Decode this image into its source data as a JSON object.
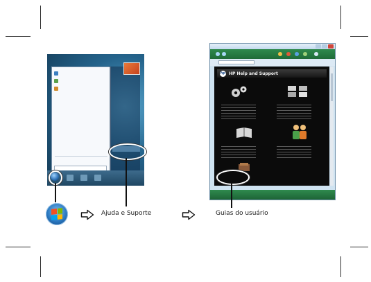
{
  "colors": {
    "desktop": "#1c4a6c",
    "start_menu_left": "#f7f9fc",
    "help_window_chrome": "#cfe3f1",
    "help_window_green_bar": "#2f8a4e",
    "help_body": "#0b0b0b",
    "callout_ring": "#ffffff"
  },
  "icons": {
    "start_orb": "windows-start-orb-icon",
    "step_arrow": "outline-right-arrow-icon"
  },
  "start_menu_screenshot": {
    "left_items": [
      "",
      "",
      ""
    ],
    "right_items": [
      "",
      "",
      "",
      "",
      "",
      "",
      "",
      "",
      "",
      ""
    ],
    "all_programs": "",
    "search_placeholder": ""
  },
  "help_window": {
    "title": "",
    "header_title": "HP Help and Support",
    "logo_text": "hp"
  },
  "steps": {
    "step1_label": "Ajuda e Suporte",
    "step2_label": "Guias do usuário"
  }
}
